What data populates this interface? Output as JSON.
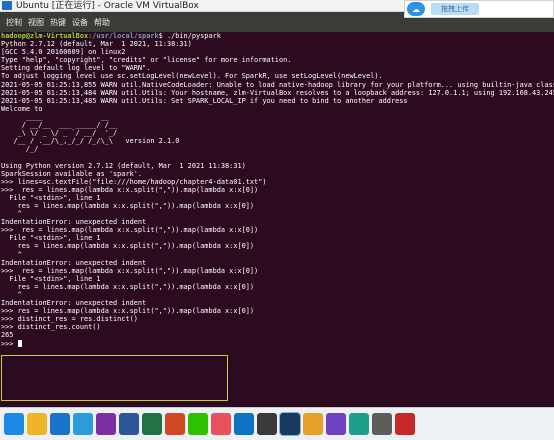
{
  "window": {
    "title": "Ubuntu [正在运行] - Oracle VM VirtualBox"
  },
  "ubuntu_panel": {
    "menus": [
      "控制",
      "视图",
      "热键",
      "设备",
      "帮助"
    ]
  },
  "overlay": {
    "button_label": "拖拽上传"
  },
  "terminal": {
    "prompt": {
      "user_host": "hadoop@zlm-VirtualBox",
      "path": ":/usr/local/spark",
      "command": "$ ./bin/pyspark"
    },
    "lines": [
      "Python 2.7.12 (default, Mar  1 2021, 11:38:31)",
      "[GCC 5.4.0 20160609] on linux2",
      "Type \"help\", \"copyright\", \"credits\" or \"license\" for more information.",
      "Setting default log level to \"WARN\".",
      "To adjust logging level use sc.setLogLevel(newLevel). For SparkR, use setLogLevel(newLevel).",
      "2021-05-05 01:25:13,855 WARN util.NativeCodeLoader: Unable to load native-hadoop library for your platform... using builtin-java classes where applicable",
      "2021-05-05 01:25:13,484 WARN util.Utils: Your hostname, zlm-VirtualBox resolves to a loopback address: 127.0.1.1; using 192.168.43.245 instead (on interface enp",
      "2021-05-05 01:25:13,485 WARN util.Utils: Set SPARK_LOCAL_IP if you need to bind to another address",
      "Welcome to",
      "      ____              __",
      "     / __/__  ___ _____/ /__",
      "    _\\ \\/ _ \\/ _ `/ __/  '_/",
      "   /__ / .__/\\_,_/_/ /_/\\_\\   version 2.1.0",
      "      /_/",
      "",
      "Using Python version 2.7.12 (default, Mar  1 2021 11:38:31)",
      "SparkSession available as 'spark'.",
      ">>> lines=sc.textFile(\"file:///home/hadoop/chapter4-data01.txt\")",
      ">>>  res = lines.map(lambda x:x.split(\",\")).map(lambda x:x[0])",
      "  File \"<stdin>\", line 1",
      "    res = lines.map(lambda x:x.split(\",\")).map(lambda x:x[0])",
      "    ^",
      "IndentationError: unexpected indent",
      ">>>  res = lines.map(lambda x:x.split(\",\")).map(lambda x:x[0])",
      "  File \"<stdin>\", line 1",
      "    res = lines.map(lambda x:x.split(\",\")).map(lambda x:x[0])",
      "    ^",
      "IndentationError: unexpected indent",
      ">>>  res = lines.map(lambda x:x.split(\",\")).map(lambda x:x[0])",
      "  File \"<stdin>\", line 1",
      "    res = lines.map(lambda x:x.split(\",\")).map(lambda x:x[0])",
      "    ^",
      "IndentationError: unexpected indent",
      ">>> res = lines.map(lambda x:x.split(\",\")).map(lambda x:x[0])",
      ">>> distinct_res = res.distinct()",
      ">>> distinct_res.count()",
      "265",
      ">>> "
    ]
  },
  "colors": {
    "terminal_bg": "#2c0a1f",
    "highlight": "#c5d524",
    "prompt_user": "#8ae234",
    "prompt_path": "#729fcf"
  },
  "taskbar": {
    "icons": [
      {
        "name": "start-icon",
        "color": "#1e88e5"
      },
      {
        "name": "file-explorer-icon",
        "color": "#f0b429"
      },
      {
        "name": "edge-icon",
        "color": "#1a73c9"
      },
      {
        "name": "qq-browser-icon",
        "color": "#2d9cdb"
      },
      {
        "name": "onenote-icon",
        "color": "#7b2fa3"
      },
      {
        "name": "word-icon",
        "color": "#2b579a"
      },
      {
        "name": "excel-icon",
        "color": "#217346"
      },
      {
        "name": "powerpoint-icon",
        "color": "#d24726"
      },
      {
        "name": "wechat-icon",
        "color": "#2dc100"
      },
      {
        "name": "paint-icon",
        "color": "#e8505b"
      },
      {
        "name": "vscode-icon",
        "color": "#0e73c4"
      },
      {
        "name": "terminal-icon",
        "color": "#3a3a3a"
      },
      {
        "name": "virtualbox-icon",
        "color": "#183a61"
      },
      {
        "name": "app-icon-14",
        "color": "#e9a02b"
      },
      {
        "name": "app-icon-15",
        "color": "#6f42c1"
      },
      {
        "name": "app-icon-16",
        "color": "#1f9e89"
      },
      {
        "name": "app-icon-17",
        "color": "#5c5c5c"
      },
      {
        "name": "app-icon-18",
        "color": "#c62828"
      }
    ]
  }
}
